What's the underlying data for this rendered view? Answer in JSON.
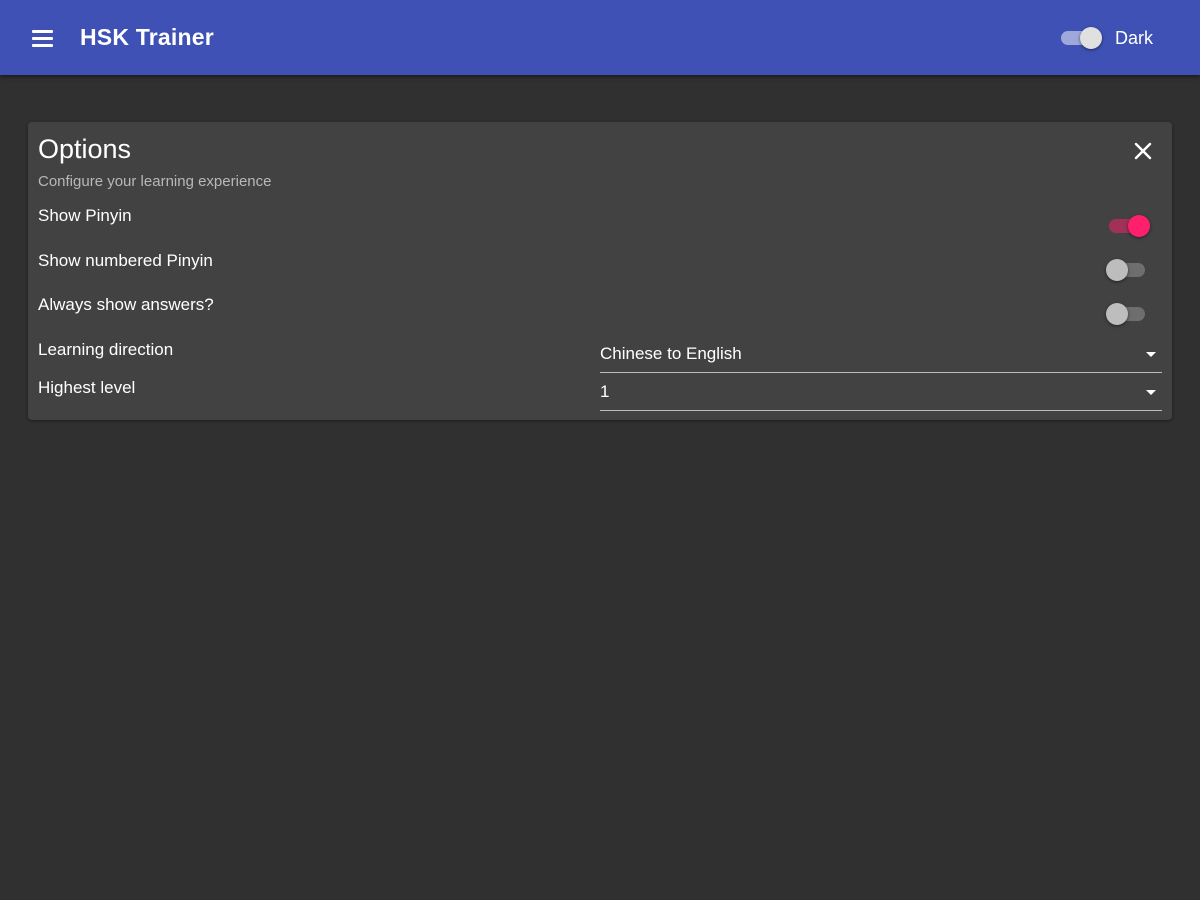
{
  "appbar": {
    "title": "HSK Trainer",
    "menu_icon": "hamburger-menu-icon",
    "dark_toggle": {
      "label": "Dark",
      "on": true
    }
  },
  "options": {
    "title": "Options",
    "subtitle": "Configure your learning experience",
    "close_icon": "close-icon",
    "toggles": [
      {
        "label": "Show Pinyin",
        "on": true
      },
      {
        "label": "Show numbered Pinyin",
        "on": false
      },
      {
        "label": "Always show answers?",
        "on": false
      }
    ],
    "selects": [
      {
        "label": "Learning direction",
        "value": "Chinese to English"
      },
      {
        "label": "Highest level",
        "value": "1"
      }
    ]
  },
  "colors": {
    "appbar": "#3f51b5",
    "background": "#303030",
    "card": "#424242",
    "accent": "#ff1f6d",
    "switch_off_thumb": "#bdbdbd",
    "switch_off_track": "#6e6e6e",
    "dark_switch_thumb": "#e0e0e0",
    "dark_switch_track": "#9fa8da"
  }
}
